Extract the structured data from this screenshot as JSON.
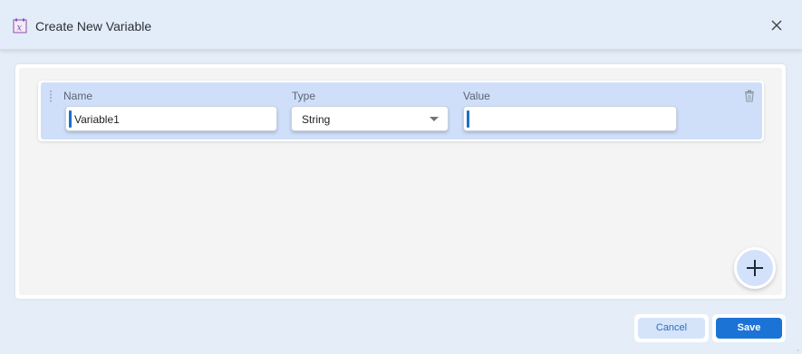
{
  "dialog": {
    "title": "Create New Variable",
    "icon": "variable-icon",
    "close_icon": "close-icon"
  },
  "variable_row": {
    "name_label": "Name",
    "name_value": "Variable1",
    "type_label": "Type",
    "type_value": "String",
    "value_label": "Value",
    "value_value": "",
    "delete_icon": "trash-icon",
    "drag_icon": "drag-handle-icon"
  },
  "add_button_icon": "plus-icon",
  "footer": {
    "cancel_label": "Cancel",
    "save_label": "Save"
  },
  "colors": {
    "accent": "#1c73d6",
    "row_highlight": "#cfdffa",
    "background": "#e4edf8"
  }
}
